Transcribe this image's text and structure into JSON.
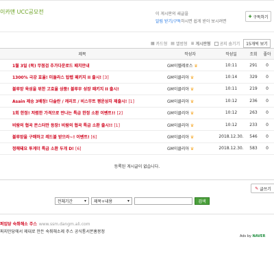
{
  "board": {
    "title": "이카맨 UCC공모전"
  },
  "subscribe": {
    "line1": "이 게시판의 새글을",
    "line2_link": "알림 받기/구독",
    "line2_rest": "하시면 쉽게 받아 보시려면",
    "button_label": "구독하기"
  },
  "view_options": {
    "card": "카드형",
    "album": "앨범형",
    "list": "게시판형",
    "notice_hide": "공지 숨기기",
    "per_page": "15개씩 보기"
  },
  "table": {
    "headers": {
      "title": "제목",
      "author": "작성자",
      "date": "작성일",
      "views": "조회",
      "likes": "좋아"
    },
    "rows": [
      {
        "title": "1월 3일 (목) 무점검 추가다운로드 패치안내",
        "count": "",
        "author": "GM이헬레로스",
        "date": "10:11",
        "views": "291",
        "likes": "0"
      },
      {
        "title": "1300% 극강 효율! 미들라스 탑렙 패키지 II 출시!",
        "count": "[3]",
        "author": "GM이클리아",
        "date": "10:14",
        "views": "329",
        "likes": "0"
      },
      {
        "title": "블루망 육성을 위한 고효율 상품! 블루우 성장 패키지 II 출시!",
        "count": "",
        "author": "GM이클리아",
        "date": "10:11",
        "views": "219",
        "likes": "0"
      },
      {
        "title": "Asain 제승 3배정! 다솔란 / 캐리프 / 비스무트 평운상자 제출시!",
        "count": "[1]",
        "author": "GM이클리아",
        "date": "10:12",
        "views": "236",
        "likes": "0"
      },
      {
        "title": "1회 한정! 저렴한 가격으로 만나는 특급 한정 소환 이벤트!!",
        "count": "[2]",
        "author": "GM이클리아",
        "date": "10:12",
        "views": "263",
        "likes": "0"
      },
      {
        "title": "비람의 협곡 몬스터만 등장! 비람의 협곡 특급 소환 출시!!",
        "count": "[1]",
        "author": "GM이클리아",
        "date": "10:12",
        "views": "233",
        "likes": "0"
      },
      {
        "title": "블루망을 구매하고 레드블 받으라~! 이벤트!",
        "count": "[6]",
        "author": "GM이클리아",
        "date": "2018.12.30.",
        "views": "546",
        "likes": "0"
      },
      {
        "title": "정해돼요 투게더 특급 소환 두개 D!",
        "count": "[6]",
        "author": "GM이클리아",
        "date": "2018.12.30.",
        "views": "583",
        "likes": "0"
      }
    ]
  },
  "empty_message": "등록된 게시글이 없습니다.",
  "write_button": "글쓰기",
  "search": {
    "period": "전체기간",
    "scope": "제목+내용",
    "button": "검색"
  },
  "ad": {
    "title": "퍼입당 숙취해소 주스",
    "url": "www.ssm.dangm.ali.com",
    "desc": "퍼지만당에서 제대로 만든 숙취해소제 주스 공식통서몬홈몽정",
    "ads_by": "Ads by",
    "naver": "NAVER"
  }
}
